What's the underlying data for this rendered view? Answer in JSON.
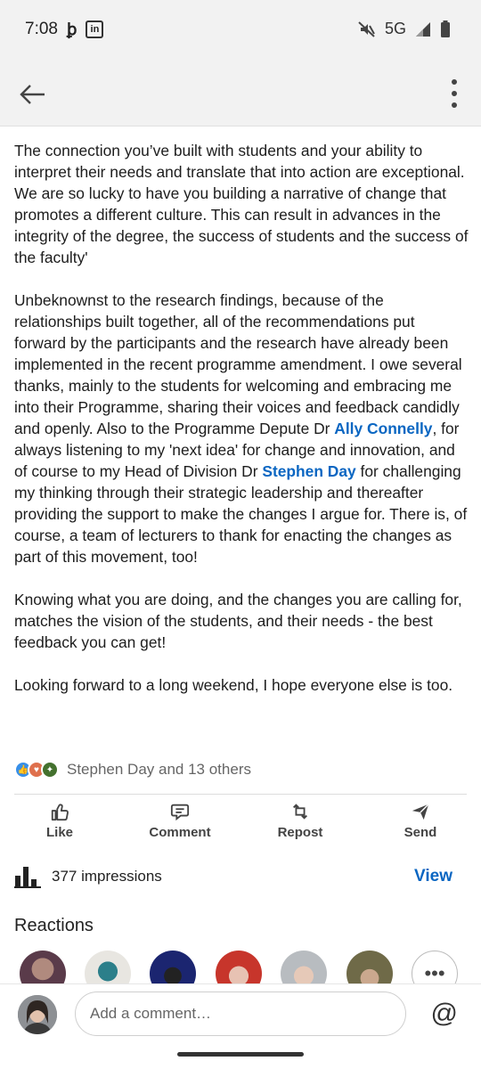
{
  "status_bar": {
    "time": "7:08",
    "network": "5G",
    "left_icons": [
      "threads-icon",
      "linkedin-icon"
    ],
    "right_icons": [
      "mute-icon",
      "signal-icon",
      "battery-icon"
    ]
  },
  "header": {
    "back_icon": "arrow-left-icon",
    "menu_icon": "more-vertical-icon"
  },
  "post": {
    "p1": "The connection you’ve built with students and your ability to interpret their needs and translate that into action are exceptional. We are so lucky to have you building a narrative of change that promotes a different culture. This can result in advances in the integrity of the degree, the success of students and the success of the faculty'",
    "p2_a": "Unbeknownst to the research findings, because of the relationships built together, all of the recommendations put forward by the participants and the research have already been implemented in the recent programme amendment. I owe several thanks, mainly to the students for welcoming and embracing me into their Programme, sharing their voices and feedback candidly and openly. Also to the Programme Depute Dr ",
    "mention_1": "Ally Connelly",
    "p2_b": ", for always listening to my 'next idea' for change and innovation, and of course to my Head of Division Dr ",
    "mention_2": "Stephen Day",
    "p2_c": " for challenging my thinking through their strategic leadership and thereafter providing the support to make the changes I argue for. There is, of course, a team of lecturers to thank for enacting the changes as part of this movement, too!",
    "p3": "Knowing what you are doing, and the changes you are calling for, matches the vision of the students, and their needs - the best feedback you can get!",
    "p4": "Looking forward to a long weekend, I hope everyone else is too."
  },
  "reactions": {
    "summary": "Stephen Day and 13 others",
    "icons": [
      "like-icon",
      "love-icon",
      "insightful-icon"
    ]
  },
  "actions": {
    "like": "Like",
    "comment": "Comment",
    "repost": "Repost",
    "send": "Send"
  },
  "impressions": {
    "label": "377 impressions",
    "view": "View"
  },
  "reactions_section": {
    "title": "Reactions",
    "more_label": "•••"
  },
  "comment_bar": {
    "placeholder": "Add a comment…",
    "mention_button": "@"
  },
  "colors": {
    "link": "#0a66c2",
    "like": "#378fe9",
    "love": "#df704d",
    "insightful": "#44712e",
    "header_bg": "#f2f2f2"
  }
}
